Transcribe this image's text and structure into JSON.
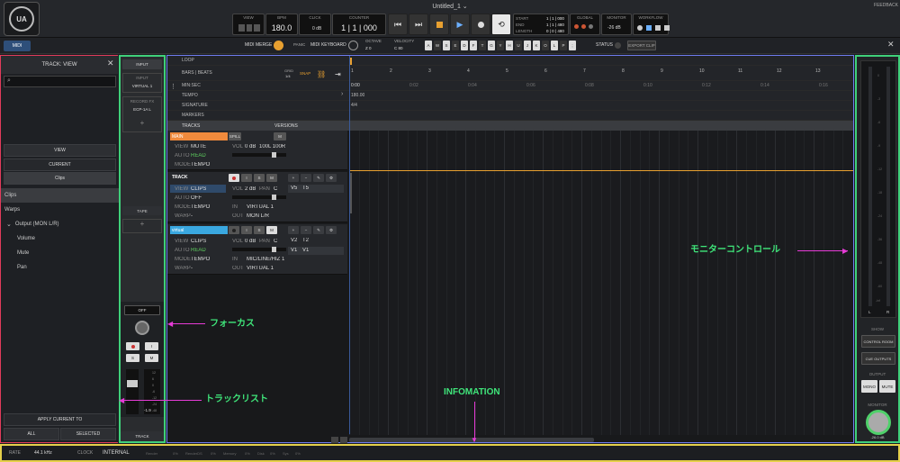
{
  "app": {
    "title": "Untitled_1",
    "feedback": "FEEDBACK"
  },
  "transport": {
    "view_label": "VIEW",
    "bpm_label": "BPM",
    "bpm": "180.0",
    "click_label": "CLICK",
    "click_val": "0 dB",
    "counter_label": "COUNTER",
    "counter": "1 | 1 | 000",
    "start_label": "START",
    "end_label": "END",
    "length_label": "LENGTH",
    "start": "1 | 1 | 000",
    "end": "1 | 1 | 480",
    "length": "0 | 0 | 480",
    "global_label": "GLOBAL",
    "monitor_label": "MONITOR",
    "monitor_val": "-26 dB",
    "workflow_label": "WORKFLOW"
  },
  "bar2": {
    "midi": "MIDI",
    "midi_merge": "MIDI MERGE",
    "panic": "PANIC",
    "midi_keyboard": "MIDI KEYBOARD",
    "octave_label": "OCTAVE",
    "octave": "Z 0",
    "velocity_label": "VELOCITY",
    "velocity": "C 80",
    "keys": [
      "A",
      "W",
      "S",
      "E",
      "D",
      "F",
      "T",
      "G",
      "Y",
      "H",
      "U",
      "J",
      "K",
      "O",
      "L",
      "P",
      ";"
    ],
    "status": "STATUS",
    "export": "EXPORT CLIP"
  },
  "left": {
    "title": "TRACK: VIEW",
    "view": "VIEW",
    "current": "CURRENT",
    "clips_btn": "Clips",
    "items": [
      "Clips",
      "Warps",
      "Output (MON L/R)",
      "Volume",
      "Mute",
      "Pan"
    ],
    "apply": "APPLY CURRENT TO",
    "all": "ALL",
    "selected": "SELECTED"
  },
  "inputcol": {
    "input_tab": "INPUT",
    "input_label": "INPUT",
    "input_val": "VIRTUAL 1",
    "record_label": "RECORD FX",
    "record_val": "ECP-1A L",
    "tape": "TAPE",
    "off": "OFF",
    "track": "TRACK",
    "fader_scale": [
      "12",
      "6",
      "0",
      "-6",
      "-12",
      "-24",
      "-48"
    ],
    "fader_val": "-1.9"
  },
  "timeline": {
    "loop": "LOOP",
    "bars_beats": "BARS | BEATS",
    "grid": "GRID",
    "grid_val": "1/4",
    "snap": "SNAP",
    "min_sec": "MIN:SEC",
    "tempo": "TEMPO",
    "tempo_val": "180.00",
    "signature": "SIGNATURE",
    "signature_val": "4/4",
    "markers": "MARKERS",
    "tracks": "TRACKS",
    "versions": "VERSIONS",
    "bars": [
      "1",
      "2",
      "3",
      "4",
      "5",
      "6",
      "7",
      "8",
      "9",
      "10",
      "11",
      "12",
      "13"
    ],
    "secs": [
      "0:00",
      "0:02",
      "0:04",
      "0:06",
      "0:08",
      "0:10",
      "0:12",
      "0:14",
      "0:16"
    ]
  },
  "tracks": [
    {
      "name": "MAIN",
      "color": "#f08a3c",
      "spill": "SPILL",
      "m": "M",
      "view": "MUTE",
      "auto": "READ",
      "mode": "TEMPO",
      "vol": "0 dB",
      "pan": "100L 100R"
    },
    {
      "name": "TRACK",
      "color": "#2f3136",
      "view": "CLIPS",
      "auto": "OFF",
      "mode": "TEMPO",
      "warp": "-",
      "vol": "2 dB",
      "pan": "C",
      "in": "VIRTUAL 1",
      "out": "MON L/R",
      "version": "V5",
      "version_name": "T5"
    },
    {
      "name": "virtual",
      "color": "#3aa8e0",
      "view": "CLIPS",
      "auto": "READ",
      "mode": "TEMPO",
      "warp": "-",
      "vol": "0 dB",
      "pan": "C",
      "in": "MIC/LINE/HIZ 1",
      "out": "VIRTUAL 1",
      "version": "V2",
      "version_name": "T2",
      "version2": "V1",
      "version2_name": "V1"
    }
  ],
  "labels_tr": {
    "view": "VIEW",
    "auto": "AUTO",
    "mode": "MODE",
    "warp": "WARP",
    "vol": "VOL",
    "pan": "PAN",
    "in": "IN",
    "out": "OUT",
    "i": "I",
    "s": "S",
    "m": "M"
  },
  "monitor": {
    "scale": [
      "0",
      "-3",
      "-6",
      "-9",
      "-12",
      "-18",
      "-24",
      "-36",
      "-48",
      "-60",
      "-inf"
    ],
    "l": "L",
    "r": "R",
    "show": "SHOW",
    "control_room": "CONTROL ROOM",
    "cue_outputs": "CUE OUTPUTS",
    "output": "OUTPUT",
    "mono": "MONO",
    "mute": "MUTE",
    "monitor": "MONITOR",
    "knob_val": "-26.0 dB"
  },
  "status": {
    "rate_label": "RATE",
    "rate": "44.1 kHz",
    "clock_label": "CLOCK",
    "clock": "INTERNAL",
    "render": "Render",
    "render_val": "0%",
    "renderdsp": "RenderDS",
    "renderdsp_val": "0%",
    "memory": "Memory",
    "memory_val": "0%",
    "disk": "Disk",
    "disk_val": "0%",
    "sys": "Sys",
    "sys_val": "0%"
  },
  "annotations": {
    "monitor_control": "モニターコントロール",
    "focus": "フォーカス",
    "tracklist": "トラックリスト",
    "information": "INFOMATION"
  }
}
